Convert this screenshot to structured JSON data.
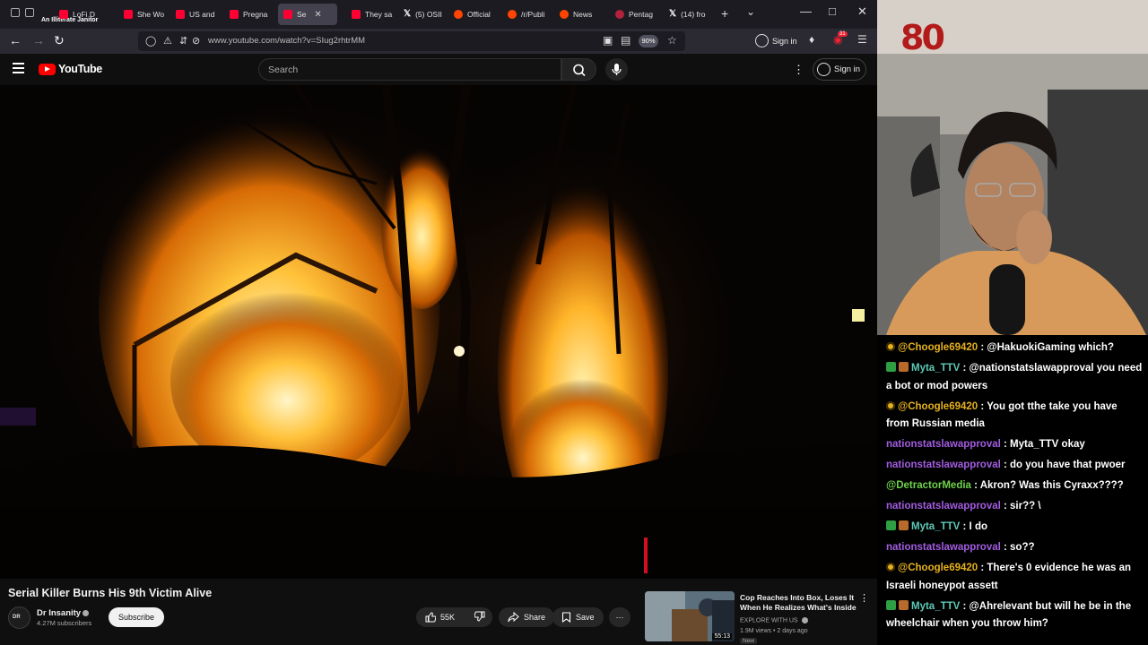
{
  "browser": {
    "stream_overlay_text": "An Illiterate Janitor",
    "tabs": [
      {
        "label": "LoFi D",
        "icon": "youtube-favicon"
      },
      {
        "label": "She Wo",
        "icon": "youtube-favicon"
      },
      {
        "label": "US and",
        "icon": "youtube-favicon"
      },
      {
        "label": "Pregna",
        "icon": "youtube-favicon"
      },
      {
        "label": "Se",
        "icon": "youtube-favicon"
      },
      {
        "label": "They sa",
        "icon": "youtube-favicon"
      },
      {
        "label": "(5) OSII",
        "icon": "x-favicon"
      },
      {
        "label": "Official",
        "icon": "reddit-favicon"
      },
      {
        "label": "/r/Publi",
        "icon": "reddit-favicon"
      },
      {
        "label": "News",
        "icon": "reddit-favicon"
      },
      {
        "label": "Pentag",
        "icon": "pentagon-favicon"
      },
      {
        "label": "(14) fro",
        "icon": "x-favicon"
      }
    ],
    "url": "www.youtube.com/watch?v=SIug2rhtrMM",
    "zoom": "90%",
    "signin_label": "Sign in",
    "extension_badge": "31"
  },
  "youtube": {
    "logo_text": "YouTube",
    "search_placeholder": "Search",
    "signin_label": "Sign in",
    "video": {
      "title": "Serial Killer Burns His 9th Victim Alive",
      "channel": "Dr Insanity",
      "subscribers": "4.27M subscribers",
      "avatar_text": "DR",
      "subscribe_label": "Subscribe",
      "likes": "55K",
      "share_label": "Share",
      "save_label": "Save"
    },
    "recommendation": {
      "title": "Cop Reaches Into Box, Loses It When He Realizes What's Inside",
      "channel": "EXPLORE WITH US",
      "meta": "1.9M views • 2 days ago",
      "badge": "New",
      "duration": "55:13"
    }
  },
  "stream": {
    "logo_number": "80",
    "chat": [
      {
        "badges": [
          "star"
        ],
        "user": "@Choogle69420",
        "color": "#e6b11e",
        "text": " : @HakuokiGaming which?"
      },
      {
        "badges": [
          "check",
          "sword"
        ],
        "user": "Myta_TTV",
        "color": "#5fc9b6",
        "text": " : @nationstatslawapproval you need a bot or mod powers"
      },
      {
        "badges": [
          "star"
        ],
        "user": "@Choogle69420",
        "color": "#e6b11e",
        "text": " : You got tthe take you have from Russian media"
      },
      {
        "badges": [],
        "user": "nationstatslawapproval",
        "color": "#a25ce0",
        "text": " : Myta_TTV okay"
      },
      {
        "badges": [],
        "user": "nationstatslawapproval",
        "color": "#a25ce0",
        "text": " : do you have that pwoer"
      },
      {
        "badges": [],
        "user": "@DetractorMedia",
        "color": "#6fd34a",
        "text": " : Akron? Was this Cyraxx????"
      },
      {
        "badges": [],
        "user": "nationstatslawapproval",
        "color": "#a25ce0",
        "text": " : sir?? \\"
      },
      {
        "badges": [
          "check",
          "sword"
        ],
        "user": "Myta_TTV",
        "color": "#5fc9b6",
        "text": " : I do"
      },
      {
        "badges": [],
        "user": "nationstatslawapproval",
        "color": "#a25ce0",
        "text": " : so??"
      },
      {
        "badges": [
          "star"
        ],
        "user": "@Choogle69420",
        "color": "#e6b11e",
        "text": " : There's 0 evidence he was an Israeli honeypot assett"
      },
      {
        "badges": [
          "check",
          "sword"
        ],
        "user": "Myta_TTV",
        "color": "#5fc9b6",
        "text": " : @Ahrelevant but will he be in the wheelchair when you throw him?"
      }
    ]
  }
}
